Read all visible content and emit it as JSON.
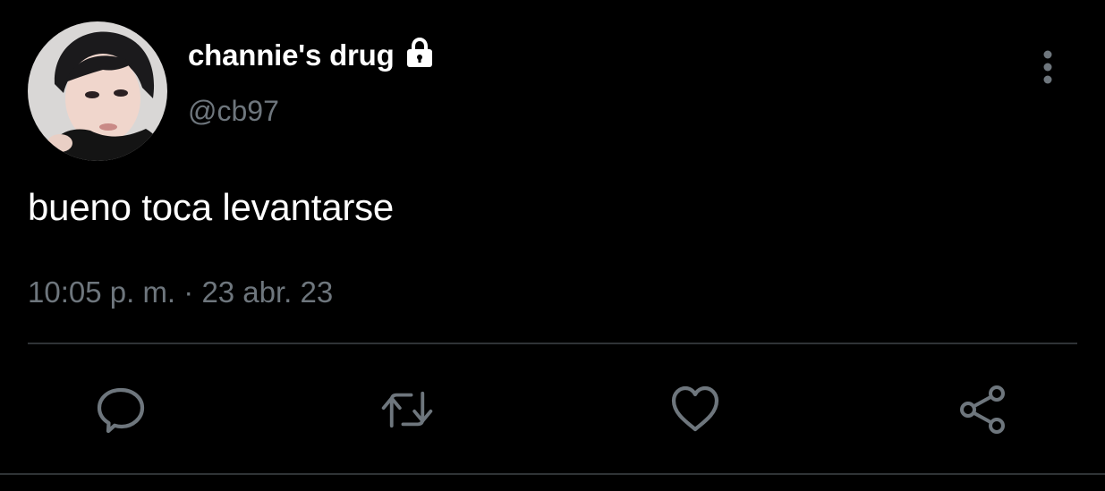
{
  "tweet": {
    "author": {
      "display_name": "channie's drug",
      "handle": "@cb97",
      "protected_icon": "lock-icon",
      "avatar_icon": "profile-photo"
    },
    "text": "bueno toca levantarse",
    "timestamp": {
      "time": "10:05 p. m.",
      "separator": " · ",
      "date": "23 abr. 23"
    },
    "menu_icon": "more-vertical-icon",
    "actions": [
      {
        "icon": "reply-icon"
      },
      {
        "icon": "retweet-icon"
      },
      {
        "icon": "like-icon"
      },
      {
        "icon": "share-icon"
      }
    ]
  },
  "colors": {
    "background": "#000000",
    "primary_text": "#ffffff",
    "secondary_text": "#6e767d",
    "divider": "#2f3336",
    "icon": "#6e767d"
  }
}
